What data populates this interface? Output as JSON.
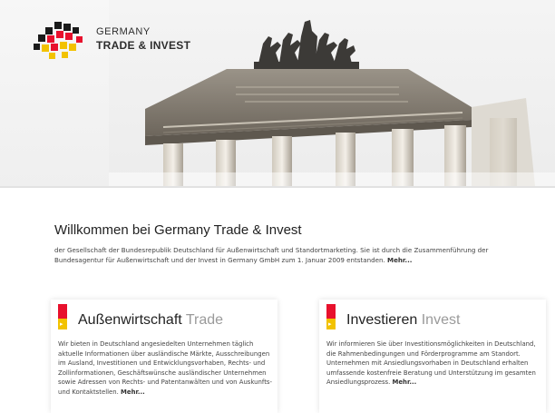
{
  "header": {
    "logo_line1": "GERMANY",
    "logo_line2": "TRADE & INVEST",
    "colors": {
      "black": "#1a1a1a",
      "red": "#e8112d",
      "gold": "#f2c200"
    }
  },
  "welcome": {
    "title": "Willkommen bei Germany Trade & Invest",
    "text": "der Gesellschaft der Bundesrepublik Deutschland für Außenwirtschaft und Standortmarketing. Sie ist durch die Zusammenführung der Bundesagentur für Außenwirtschaft und der Invest in Germany GmbH zum 1. Januar 2009 entstanden.",
    "more": "Mehr..."
  },
  "cards": [
    {
      "title_main": "Außenwirtschaft",
      "title_sub": "Trade",
      "text": "Wir bieten in Deutschland angesiedelten Unternehmen täglich aktuelle Informationen über ausländische Märkte, Ausschreibungen im Ausland, Investitionen und Entwicklungsvorhaben, Rechts- und Zollinformationen, Geschäftswünsche ausländischer Unternehmen sowie Adressen von Rechts- und Patentanwälten und von Auskunfts- und Kontaktstellen.",
      "more": "Mehr..."
    },
    {
      "title_main": "Investieren",
      "title_sub": "Invest",
      "text": "Wir informieren Sie über Investitionsmöglichkeiten in Deutschland, die Rahmenbedingungen und Förderprogramme am Standort. Unternehmen mit Ansiedlungsvorhaben in Deutschland erhalten umfassende kostenfreie Beratung und Unterstützung im gesamten Ansiedlungsprozess.",
      "more": "Mehr..."
    }
  ]
}
